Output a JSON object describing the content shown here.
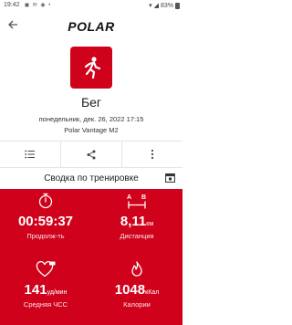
{
  "status_bar": {
    "time": "19:42",
    "battery": "83%",
    "left_icons": "◼ ✉ ◉ •",
    "right_icons": "▾ ◢"
  },
  "app_bar": {
    "brand": "POLAR",
    "back_icon": "arrow-left-icon"
  },
  "workout": {
    "sport_icon": "running-icon",
    "title": "Бег",
    "date": "понедельник, дек. 26, 2022 17:15",
    "device": "Polar Vantage M2"
  },
  "toolbar": {
    "items": [
      "list-icon",
      "share-icon",
      "more-vertical-icon"
    ]
  },
  "summary": {
    "title": "Сводка по тренировке",
    "calendar_icon": "calendar-icon"
  },
  "stats": [
    {
      "icon": "stopwatch-icon",
      "value": "00:59:37",
      "unit": "",
      "label": "Продолж-ть"
    },
    {
      "icon": "distance-ab-icon",
      "value": "8,11",
      "unit": "км",
      "label": "Дистанция"
    },
    {
      "icon": "heart-avg-icon",
      "value": "141",
      "unit": "уд/мин",
      "label": "Средняя ЧСС"
    },
    {
      "icon": "flame-icon",
      "value": "1048",
      "unit": "кКал",
      "label": "Калории"
    }
  ],
  "colors": {
    "accent": "#d0021b",
    "panel_text": "#ffffff"
  }
}
